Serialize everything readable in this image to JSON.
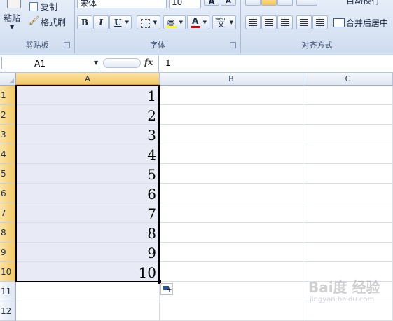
{
  "ribbon": {
    "clipboard": {
      "label": "剪贴板",
      "paste_label": "粘贴",
      "copy_label": "复制",
      "format_painter_label": "格式刷"
    },
    "font": {
      "label": "字体",
      "font_name": "宋体",
      "font_size": "10",
      "bold": "B",
      "italic": "I",
      "underline": "U",
      "font_color_glyph": "A",
      "grow_glyph": "A",
      "shrink_glyph": "A",
      "phonetic_top": "wén",
      "phonetic_char": "文"
    },
    "alignment": {
      "label": "对齐方式",
      "wrap_label": "自动换行",
      "merge_label": "合并后居中"
    }
  },
  "formula_bar": {
    "name_box": "A1",
    "fx": "fx",
    "content": "1"
  },
  "sheet": {
    "columns": [
      "A",
      "B",
      "C"
    ],
    "rows": [
      {
        "num": "1",
        "a": "1"
      },
      {
        "num": "2",
        "a": "2"
      },
      {
        "num": "3",
        "a": "3"
      },
      {
        "num": "4",
        "a": "4"
      },
      {
        "num": "5",
        "a": "5"
      },
      {
        "num": "6",
        "a": "6"
      },
      {
        "num": "7",
        "a": "7"
      },
      {
        "num": "8",
        "a": "8"
      },
      {
        "num": "9",
        "a": "9"
      },
      {
        "num": "10",
        "a": "10"
      },
      {
        "num": "11",
        "a": ""
      },
      {
        "num": "12",
        "a": ""
      }
    ]
  },
  "watermark": {
    "text": "Bai度 经验",
    "url": "jingyan.baidu.com"
  },
  "colors": {
    "selection_fill": "#e8ebf5",
    "header_highlight": "#f3c865",
    "ribbon_bg": "#dfe8f5"
  }
}
